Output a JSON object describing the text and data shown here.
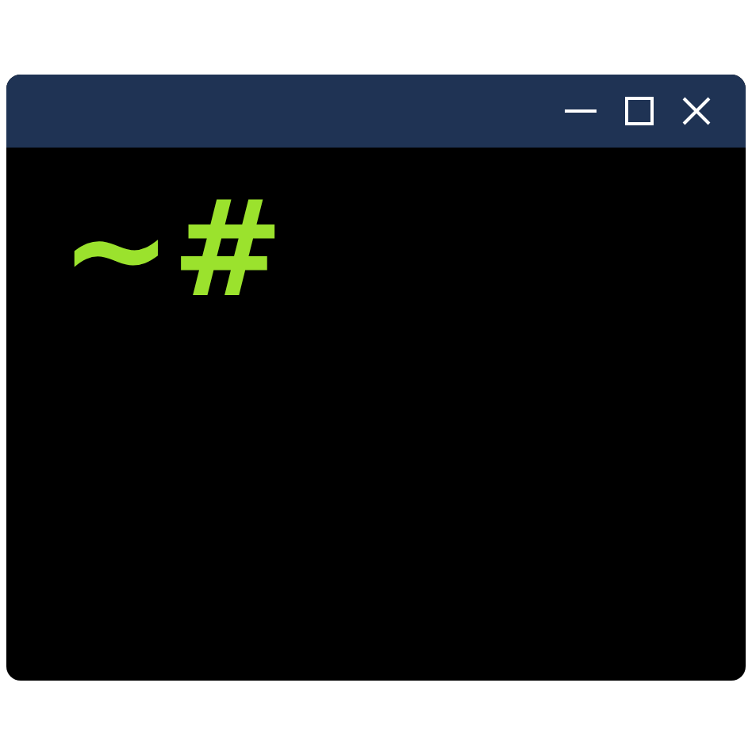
{
  "terminal": {
    "prompt": "~#"
  }
}
